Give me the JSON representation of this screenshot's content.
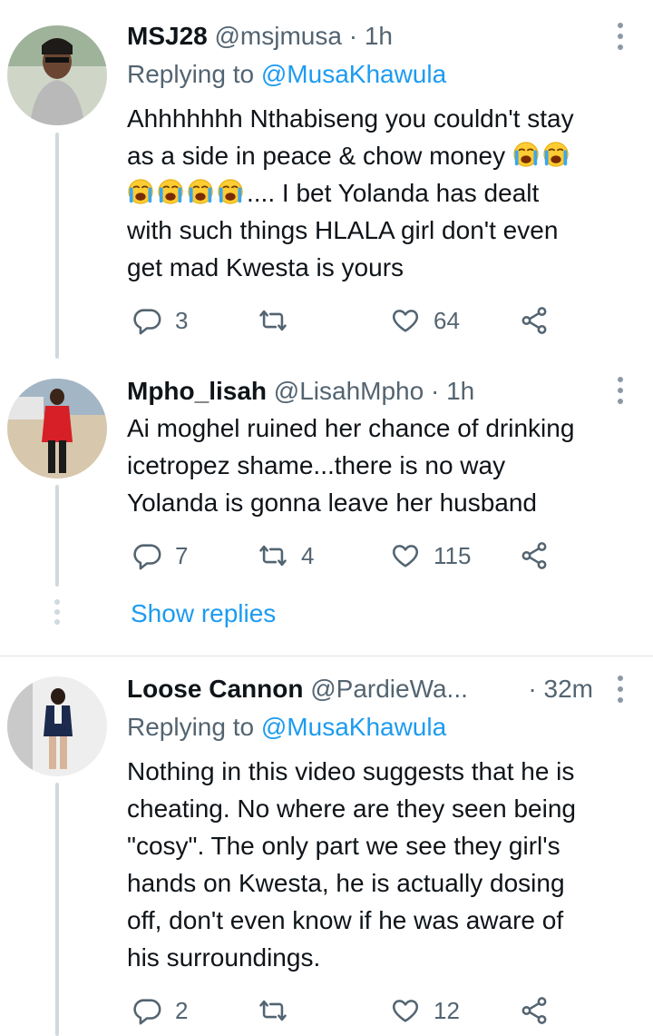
{
  "tweets": [
    {
      "name": "MSJ28",
      "handle": "@msjmusa",
      "time": "· 1h",
      "replying_prefix": "Replying to ",
      "replying_to": "@MusaKhawula",
      "text_line1": "Ahhhhhhh Nthabiseng you couldn't stay",
      "text_line2": "as a side in peace & chow money",
      "text_line3_suffix": ".... I bet Yolanda has dealt",
      "text_line4": "with such things HLALA girl don't even",
      "text_line5": "get mad Kwesta is yours",
      "emoji_name": "loudly-crying-face",
      "replies": "3",
      "retweets": "",
      "likes": "64"
    },
    {
      "name": "Mpho_lisah",
      "handle": "@LisahMpho",
      "time": "· 1h",
      "text_line1": "Ai moghel ruined her chance of drinking",
      "text_line2": "icetropez shame...there is no way",
      "text_line3": "Yolanda is gonna leave her husband",
      "replies": "7",
      "retweets": "4",
      "likes": "115"
    },
    {
      "name": "Loose Cannon",
      "handle": "@PardieWa...",
      "time": "· 32m",
      "replying_prefix": "Replying to ",
      "replying_to": "@MusaKhawula",
      "text_line1": "Nothing in this video suggests that he is",
      "text_line2": "cheating. No where are they seen being",
      "text_line3": "\"cosy\". The only part we see they girl's",
      "text_line4": "hands on Kwesta, he is actually dosing",
      "text_line5": "off, don't even know if he was aware of",
      "text_line6": "his surroundings.",
      "replies": "2",
      "retweets": "",
      "likes": "12"
    }
  ],
  "show_replies": "Show replies",
  "icons": {
    "reply": "reply-icon",
    "retweet": "retweet-icon",
    "like": "heart-icon",
    "share": "share-icon",
    "more": "more-options-icon"
  },
  "colors": {
    "link": "#1d9bf0",
    "secondary": "#536471",
    "text": "#0f1419",
    "thread_line": "#cfd9de"
  }
}
